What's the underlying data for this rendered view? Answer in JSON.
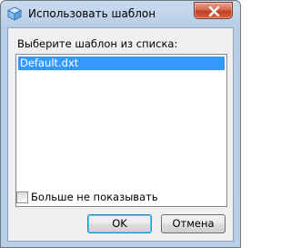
{
  "window": {
    "title": "Использовать шаблон",
    "icons": {
      "app": "app-box-icon",
      "close": "close-icon"
    }
  },
  "prompt": "Выберите шаблон из списка:",
  "template_list": {
    "items": [
      {
        "label": "Default.dxt",
        "selected": true
      }
    ]
  },
  "dont_show": {
    "label": "Больше не показывать",
    "checked": false
  },
  "buttons": {
    "ok": "OK",
    "cancel": "Отмена"
  },
  "colors": {
    "selection": "#3399ff",
    "close_button": "#c2401f",
    "frame": "#b9cfe8"
  }
}
